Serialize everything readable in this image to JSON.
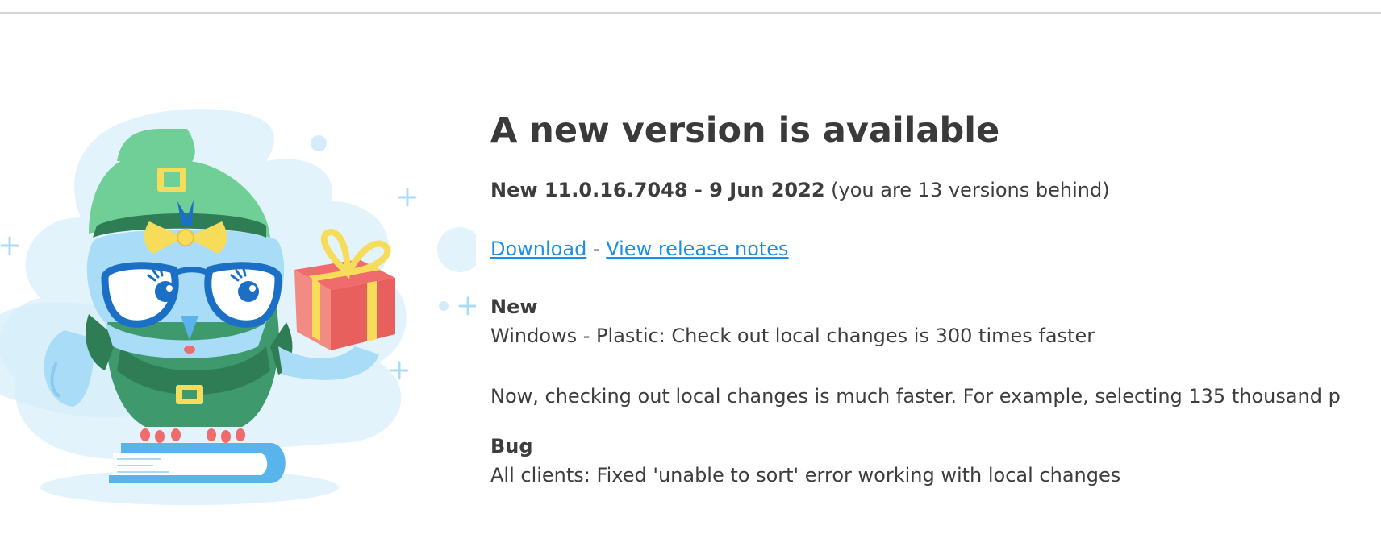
{
  "update_notice": {
    "title": "A new version is available",
    "version_label": "New 11.0.16.7048 - 9 Jun 2022",
    "behind_text": "(you are 13 versions behind)",
    "download_link": "Download",
    "separator": "-",
    "release_notes_link": "View release notes",
    "sections": [
      {
        "heading": "New",
        "lines": [
          "Windows - Plastic: Check out local changes is 300 times faster",
          "Now, checking out local changes is much faster. For example, selecting 135 thousand p"
        ]
      },
      {
        "heading": "Bug",
        "lines": [
          "All clients: Fixed 'unable to sort' error working with local changes"
        ]
      }
    ]
  },
  "illustration": {
    "icon": "owl-with-gift-icon",
    "colors": {
      "owl_green": "#3e9a6c",
      "hat_green": "#6fcf97",
      "owl_blue": "#a8dcf7",
      "glasses_blue": "#1b6fc4",
      "gift_red": "#f06b6b",
      "ribbon_yellow": "#f7dc5a",
      "background_blue": "#e3f3fc"
    }
  }
}
